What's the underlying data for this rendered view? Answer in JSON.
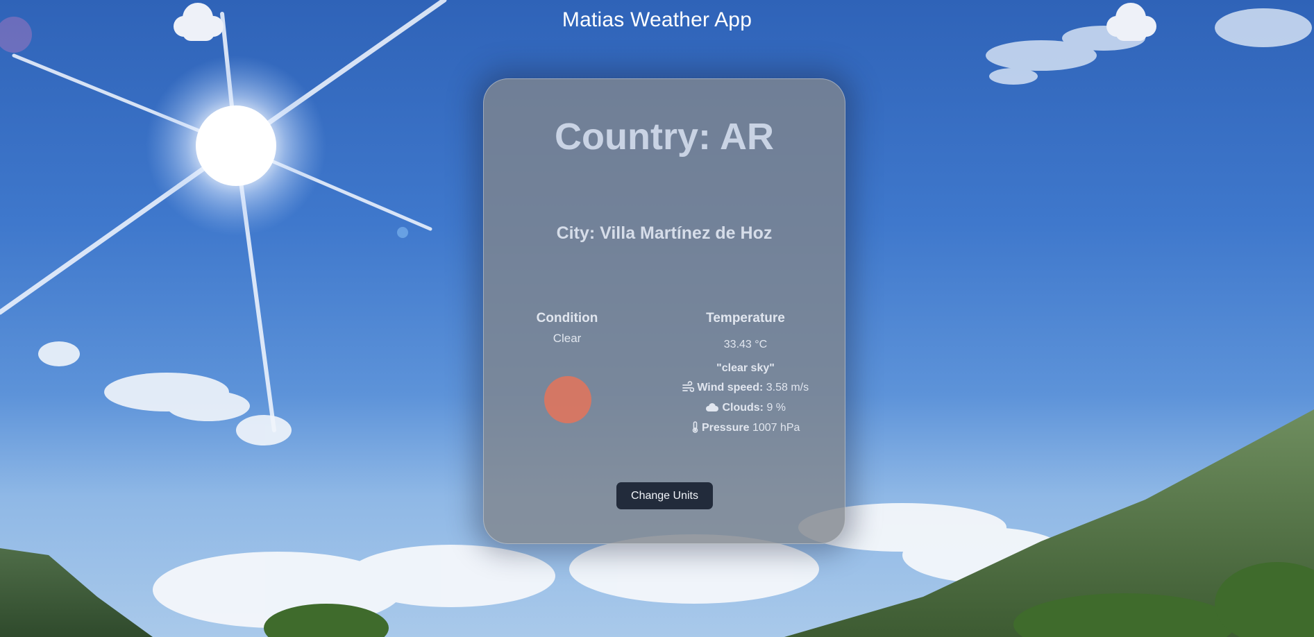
{
  "app": {
    "title": "Matias Weather App"
  },
  "location": {
    "country_label": "Country:",
    "country_value": "AR",
    "city_label": "City:",
    "city_value": "Villa Martínez de Hoz"
  },
  "condition": {
    "heading": "Condition",
    "value": "Clear",
    "icon": "sun-dot-icon"
  },
  "temperature": {
    "heading": "Temperature",
    "value": "33.43 °C",
    "description": "\"clear sky\"",
    "wind_label": "Wind speed:",
    "wind_value": "3.58 m/s",
    "clouds_label": "Clouds:",
    "clouds_value": "9 %",
    "pressure_label": "Pressure",
    "pressure_value": "1007 hPa"
  },
  "actions": {
    "change_units_label": "Change Units"
  },
  "icons": {
    "header_clouds": [
      "cloud-icon",
      "cloud-icon"
    ],
    "wind": "wind-icon",
    "clouds": "cloud-icon",
    "pressure": "thermometer-icon"
  },
  "colors": {
    "card_bg": "#80848c",
    "button_bg": "#222b3b",
    "sun_dot": "#dc7560",
    "title_text": "#ffffff"
  }
}
